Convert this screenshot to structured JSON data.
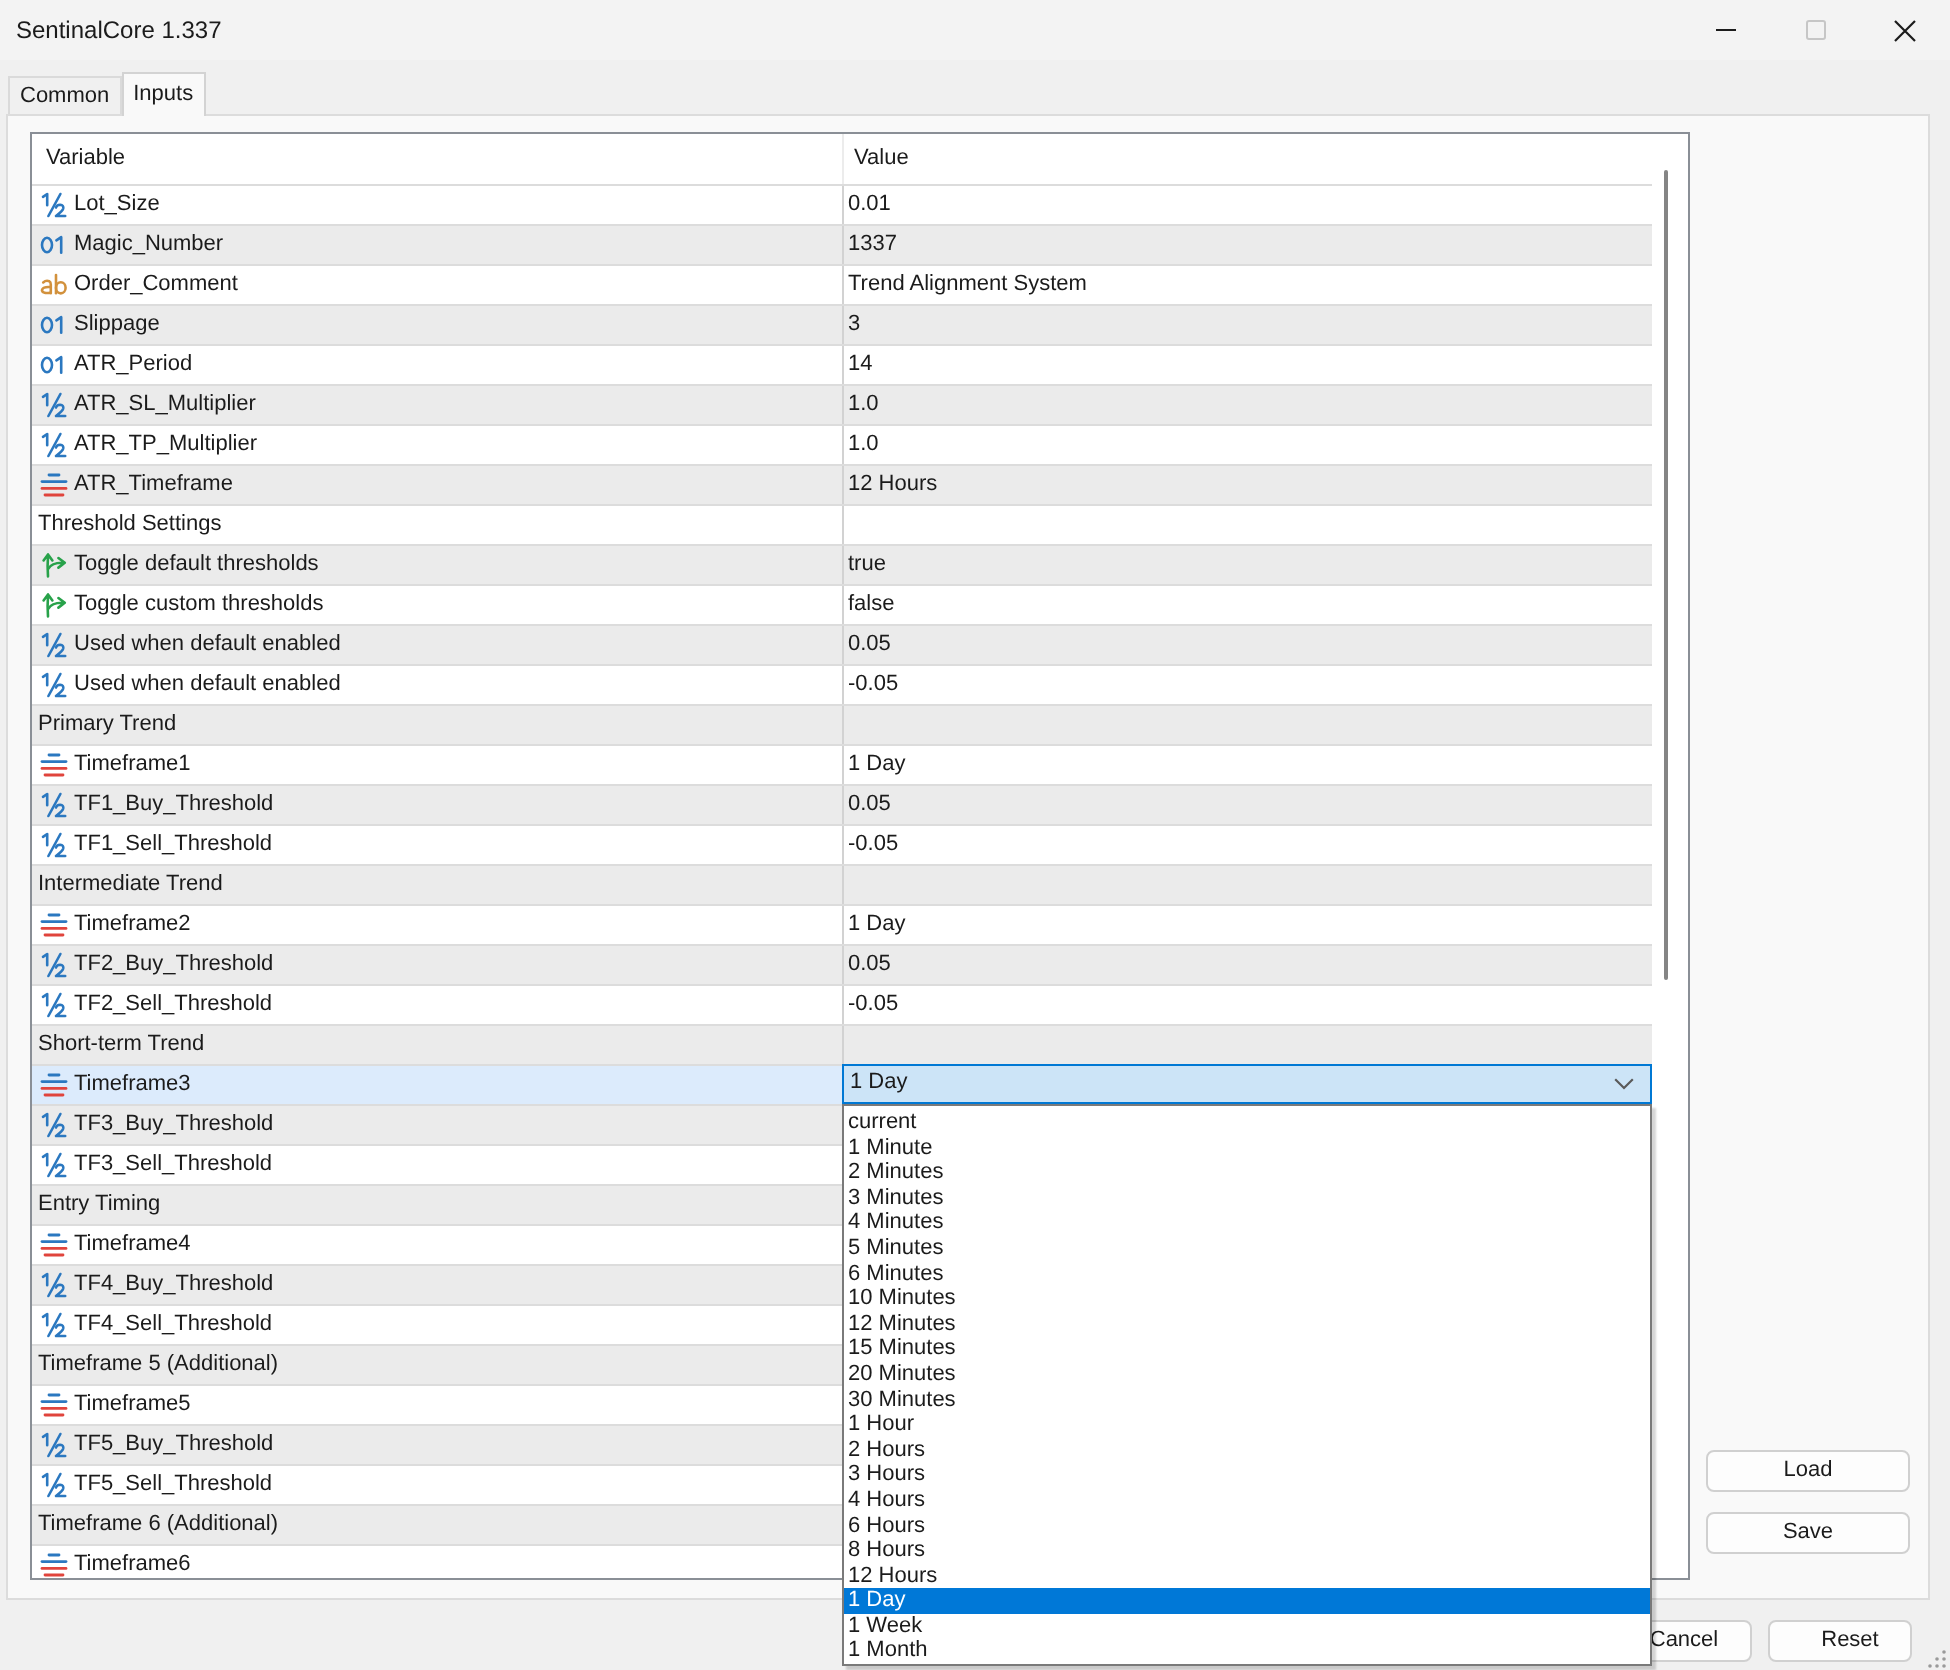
{
  "window": {
    "title": "SentinalCore 1.337",
    "controls": [
      {
        "kind": "minimize",
        "disabled": false
      },
      {
        "kind": "maximize",
        "disabled": true
      },
      {
        "kind": "close",
        "disabled": false
      }
    ]
  },
  "tabs": [
    {
      "label": "Common",
      "selected": false
    },
    {
      "label": "Inputs",
      "selected": true
    }
  ],
  "table": {
    "columns": [
      "Variable",
      "Value"
    ],
    "rows": [
      {
        "kind": "double",
        "name": "Lot_Size",
        "value": "0.01",
        "selected": false
      },
      {
        "kind": "int",
        "name": "Magic_Number",
        "value": "1337",
        "selected": false
      },
      {
        "kind": "string",
        "name": "Order_Comment",
        "value": "Trend Alignment System",
        "selected": false
      },
      {
        "kind": "int",
        "name": "Slippage",
        "value": "3",
        "selected": false
      },
      {
        "kind": "int",
        "name": "ATR_Period",
        "value": "14",
        "selected": false
      },
      {
        "kind": "double",
        "name": "ATR_SL_Multiplier",
        "value": "1.0",
        "selected": false
      },
      {
        "kind": "double",
        "name": "ATR_TP_Multiplier",
        "value": "1.0",
        "selected": false
      },
      {
        "kind": "enum",
        "name": "ATR_Timeframe",
        "value": "12 Hours",
        "selected": false
      },
      {
        "kind": "group",
        "name": "Threshold Settings",
        "selected": false
      },
      {
        "kind": "bool",
        "name": "Toggle default thresholds",
        "value": "true",
        "selected": false
      },
      {
        "kind": "bool",
        "name": "Toggle custom thresholds",
        "value": "false",
        "selected": false
      },
      {
        "kind": "double",
        "name": "Used when default enabled",
        "value": "0.05",
        "selected": false
      },
      {
        "kind": "double",
        "name": "Used when default enabled",
        "value": "-0.05",
        "selected": false
      },
      {
        "kind": "group",
        "name": "Primary Trend",
        "selected": false
      },
      {
        "kind": "enum",
        "name": "Timeframe1",
        "value": "1 Day",
        "selected": false
      },
      {
        "kind": "double",
        "name": "TF1_Buy_Threshold",
        "value": "0.05",
        "selected": false
      },
      {
        "kind": "double",
        "name": "TF1_Sell_Threshold",
        "value": "-0.05",
        "selected": false
      },
      {
        "kind": "group",
        "name": "Intermediate Trend",
        "selected": false
      },
      {
        "kind": "enum",
        "name": "Timeframe2",
        "value": "1 Day",
        "selected": false
      },
      {
        "kind": "double",
        "name": "TF2_Buy_Threshold",
        "value": "0.05",
        "selected": false
      },
      {
        "kind": "double",
        "name": "TF2_Sell_Threshold",
        "value": "-0.05",
        "selected": false
      },
      {
        "kind": "group",
        "name": "Short-term Trend",
        "selected": false
      },
      {
        "kind": "enum",
        "name": "Timeframe3",
        "value": "1 Day",
        "selected": true
      },
      {
        "kind": "double",
        "name": "TF3_Buy_Threshold",
        "selected": false
      },
      {
        "kind": "double",
        "name": "TF3_Sell_Threshold",
        "selected": false
      },
      {
        "kind": "group",
        "name": "Entry Timing",
        "selected": false
      },
      {
        "kind": "enum",
        "name": "Timeframe4",
        "selected": false
      },
      {
        "kind": "double",
        "name": "TF4_Buy_Threshold",
        "selected": false
      },
      {
        "kind": "double",
        "name": "TF4_Sell_Threshold",
        "selected": false
      },
      {
        "kind": "group",
        "name": "Timeframe 5 (Additional)",
        "selected": false
      },
      {
        "kind": "enum",
        "name": "Timeframe5",
        "selected": false
      },
      {
        "kind": "double",
        "name": "TF5_Buy_Threshold",
        "selected": false
      },
      {
        "kind": "double",
        "name": "TF5_Sell_Threshold",
        "selected": false
      },
      {
        "kind": "group",
        "name": "Timeframe 6 (Additional)",
        "selected": false
      },
      {
        "kind": "enum",
        "name": "Timeframe6",
        "selected": false
      }
    ],
    "dropdown": {
      "options": [
        {
          "label": "current",
          "selected": false
        },
        {
          "label": "1 Minute",
          "selected": false
        },
        {
          "label": "2 Minutes",
          "selected": false
        },
        {
          "label": "3 Minutes",
          "selected": false
        },
        {
          "label": "4 Minutes",
          "selected": false
        },
        {
          "label": "5 Minutes",
          "selected": false
        },
        {
          "label": "6 Minutes",
          "selected": false
        },
        {
          "label": "10 Minutes",
          "selected": false
        },
        {
          "label": "12 Minutes",
          "selected": false
        },
        {
          "label": "15 Minutes",
          "selected": false
        },
        {
          "label": "20 Minutes",
          "selected": false
        },
        {
          "label": "30 Minutes",
          "selected": false
        },
        {
          "label": "1 Hour",
          "selected": false
        },
        {
          "label": "2 Hours",
          "selected": false
        },
        {
          "label": "3 Hours",
          "selected": false
        },
        {
          "label": "4 Hours",
          "selected": false
        },
        {
          "label": "6 Hours",
          "selected": false
        },
        {
          "label": "8 Hours",
          "selected": false
        },
        {
          "label": "12 Hours",
          "selected": false
        },
        {
          "label": "1 Day",
          "selected": true
        },
        {
          "label": "1 Week",
          "selected": false
        },
        {
          "label": "1 Month",
          "selected": false
        }
      ]
    }
  },
  "side_buttons": [
    "Load",
    "Save"
  ],
  "footer_buttons": [
    "Cancel",
    "Reset"
  ]
}
